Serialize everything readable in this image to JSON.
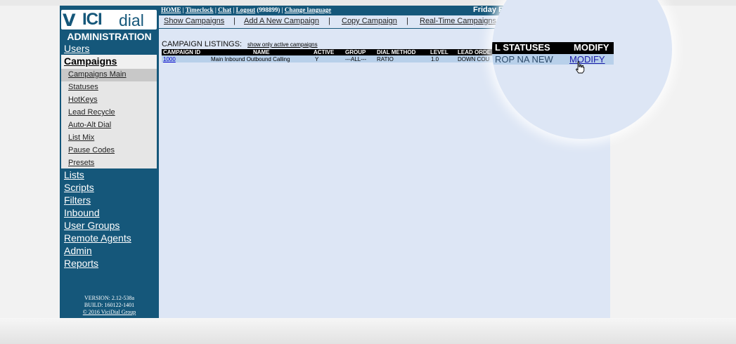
{
  "brand": {
    "logo_v": "V",
    "logo_text_bold": "ICI",
    "logo_text_light": "dial",
    "admin_title": "ADMINISTRATION"
  },
  "sidebar": {
    "items_before": [
      {
        "label": "Users"
      }
    ],
    "active": {
      "label": "Campaigns"
    },
    "submenu": [
      {
        "label": "Campaigns Main"
      },
      {
        "label": "Statuses"
      },
      {
        "label": "HotKeys"
      },
      {
        "label": "Lead Recycle"
      },
      {
        "label": "Auto-Alt Dial"
      },
      {
        "label": "List Mix"
      },
      {
        "label": "Pause Codes"
      },
      {
        "label": "Presets"
      }
    ],
    "items_after": [
      {
        "label": "Lists"
      },
      {
        "label": "Scripts"
      },
      {
        "label": "Filters"
      },
      {
        "label": "Inbound"
      },
      {
        "label": "User Groups"
      },
      {
        "label": "Remote Agents"
      },
      {
        "label": "Admin"
      },
      {
        "label": "Reports"
      }
    ],
    "version": "VERSION: 2.12-538a",
    "build": "BUILD: 160122-1401",
    "copyright": "© 2016 ViciDial Group"
  },
  "topbar": {
    "home": "HOME",
    "timeclock": "Timeclock",
    "chat": "Chat",
    "logout": "Logout",
    "user": "(998899)",
    "change_language": "Change language",
    "sep": "|",
    "date": "Friday Fe"
  },
  "menubar": {
    "show": "Show Campaigns",
    "add": "Add A New Campaign",
    "copy": "Copy Campaign",
    "realtime": "Real-Time Campaigns S",
    "sep": "|"
  },
  "listing": {
    "title": "CAMPAIGN LISTINGS:",
    "active_link": "show only active campaigns",
    "columns": {
      "id": "CAMPAIGN ID",
      "name": "NAME",
      "active": "ACTIVE",
      "group": "GROUP",
      "dial": "DIAL METHOD",
      "level": "LEVEL",
      "lead": "LEAD ORDE"
    },
    "row": {
      "id": "1000",
      "name": "Main Inbound Outbound Calling",
      "active": "Y",
      "group": "---ALL---",
      "dial": "RATIO",
      "level": "1.0",
      "lead": "DOWN COU"
    }
  },
  "lens": {
    "statuses_header": "L STATUSES",
    "modify_header": "MODIFY",
    "statuses_value": "ROP NA NEW",
    "modify_link": "MODIFY"
  },
  "colors": {
    "sidebar": "#15577a",
    "content_bg": "#dde6f5",
    "row_bg": "#b8d0ea"
  }
}
